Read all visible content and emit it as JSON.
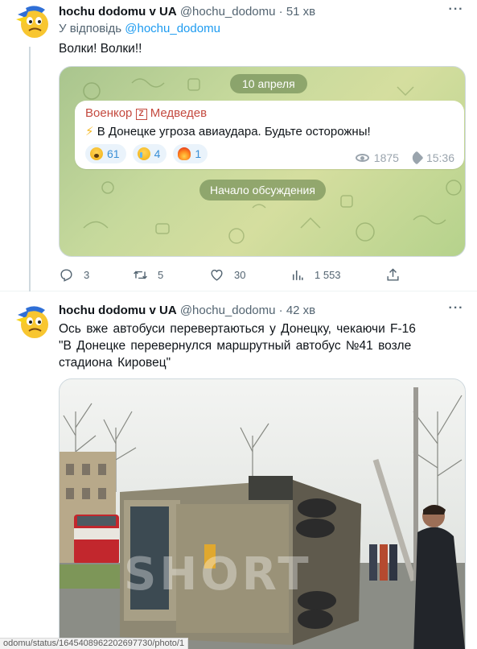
{
  "tweet1": {
    "display_name": "hochu dodomu v UA",
    "handle": "@hochu_dodomu",
    "separator": "·",
    "time": "51 хв",
    "reply_prefix": "У відповідь",
    "reply_handle": "@hochu_dodomu",
    "text": "Волки! Волки!!",
    "telegram": {
      "date": "10 апреля",
      "sender": "Военкор",
      "sender_badge": "Z",
      "sender_suffix": "Медведев",
      "message_icon": "⚡",
      "message": "В Донецке угроза авиаудара. Будьте осторожны!",
      "reactions": [
        {
          "emoji": "scream-emoji",
          "count": "61"
        },
        {
          "emoji": "crying-emoji",
          "count": "4"
        },
        {
          "emoji": "fire-emoji",
          "count": "1"
        }
      ],
      "views": "1875",
      "time": "15:36",
      "discussion_button": "Начало обсуждения",
      "background_color": "#b9d193"
    },
    "actions": {
      "replies": "3",
      "retweets": "5",
      "likes": "30",
      "views": "1 553"
    }
  },
  "tweet2": {
    "display_name": "hochu dodomu v UA",
    "handle": "@hochu_dodomu",
    "separator": "·",
    "time": "42 хв",
    "text_line1": "Ось  вже автобуси  перевертаються у Донецку,  чекаючи  F-16",
    "text_line2": "\"В Донецке перевернулся маршрутный автобус №41 возле стадиона Кировец\"",
    "photo_watermark": "SHORT"
  },
  "status_bar_url": "odomu/status/1645408962202697730/photo/1",
  "colors": {
    "link": "#1d9bf0",
    "muted": "#536471",
    "telegram_sender": "#c44a3f",
    "telegram_reaction": "#3a8fd6"
  }
}
